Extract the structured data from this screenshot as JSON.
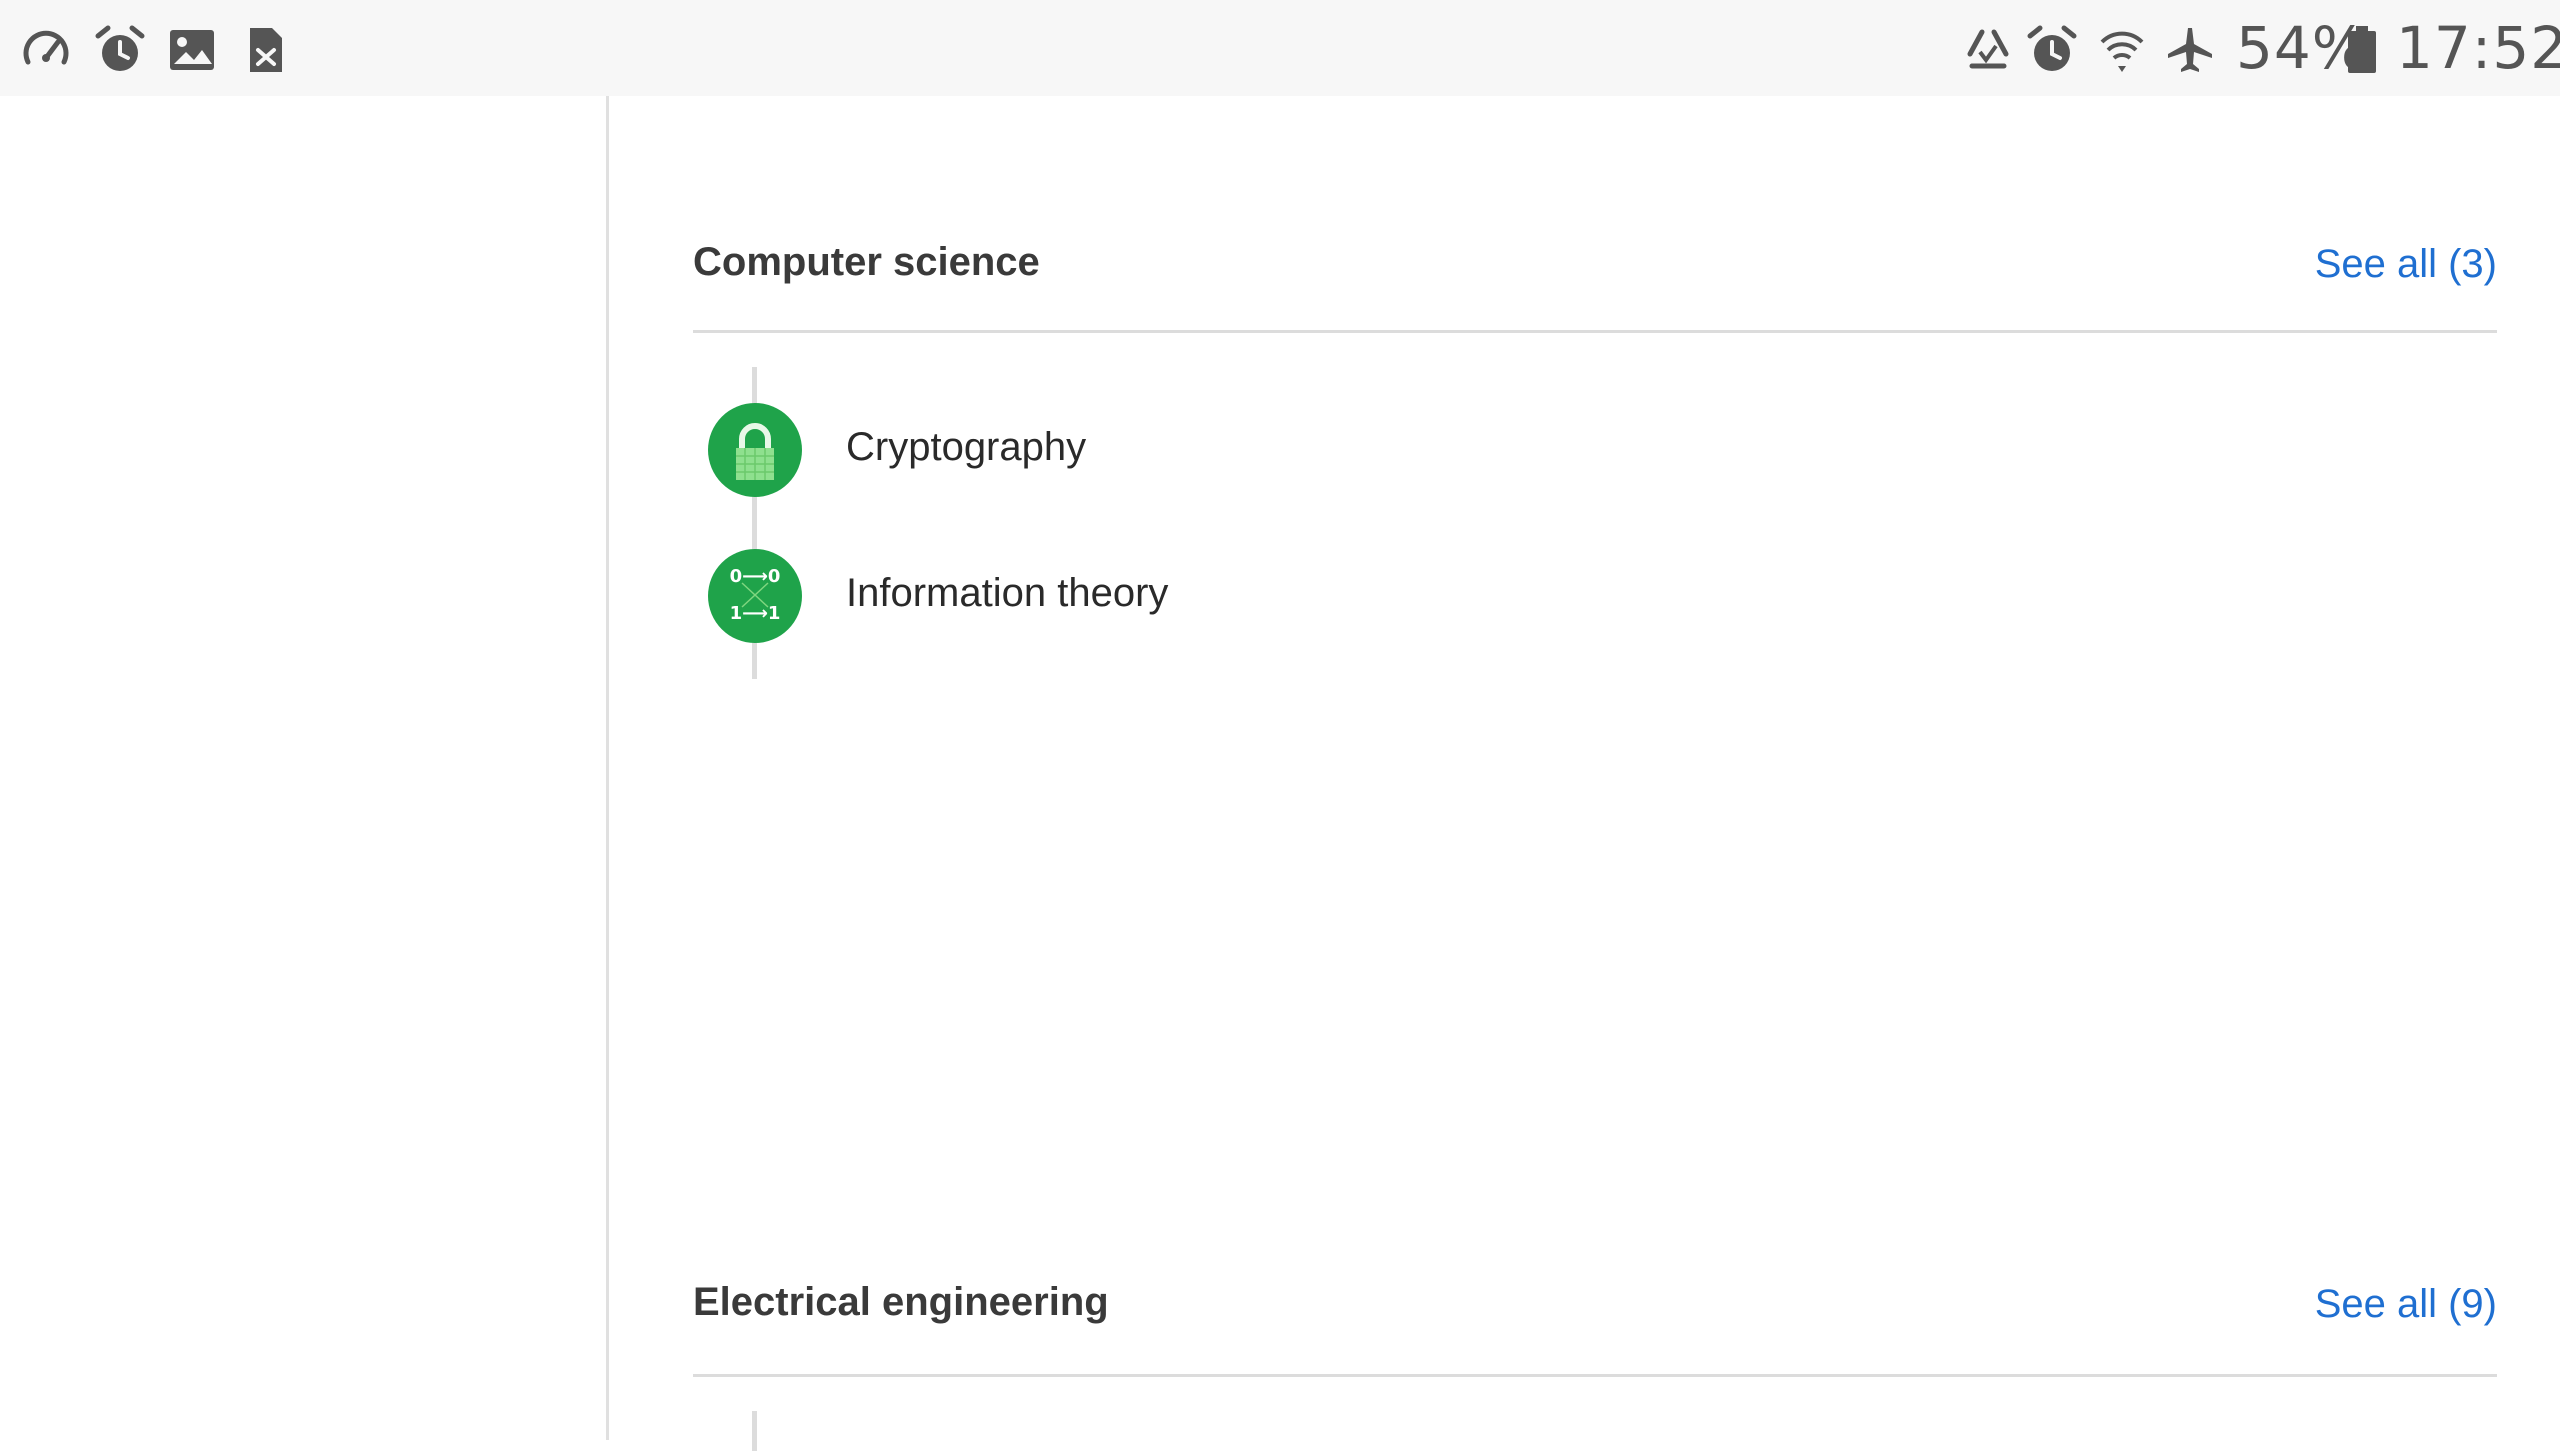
{
  "status_bar": {
    "left_icons": [
      "speedometer-icon",
      "alarm-icon",
      "image-icon",
      "sim-card-x-icon"
    ],
    "right_icons": [
      "recycle-icon",
      "alarm-icon",
      "wifi-icon",
      "airplane-icon",
      "battery-icon"
    ],
    "battery_percent": "54%",
    "time": "17:52"
  },
  "sections": [
    {
      "title": "Computer science",
      "see_all": "See all (3)",
      "topics": [
        {
          "label": "Cryptography",
          "icon": "padlock-icon"
        },
        {
          "label": "Information theory",
          "icon": "binary-channel-icon",
          "icon_text": {
            "top": "0⟶0",
            "bottom": "1⟶1"
          }
        }
      ]
    },
    {
      "title": "Electrical engineering",
      "see_all": "See all (9)",
      "topics": []
    }
  ],
  "colors": {
    "accent_link": "#1f6fd1",
    "topic_green": "#1fa34a",
    "status_bar_bg": "#f7f7f7",
    "divider": "#dcdcdc"
  }
}
